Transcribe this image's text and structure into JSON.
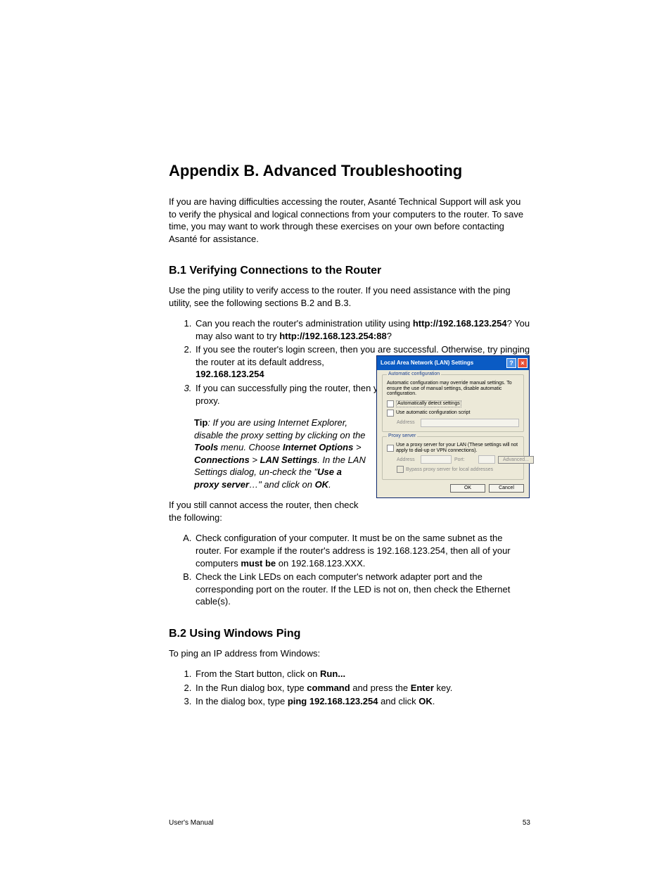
{
  "title": "Appendix B. Advanced Troubleshooting",
  "intro": "If you are having difficulties accessing the router, Asanté Technical Support will ask you to verify the physical and logical connections from your computers to the router. To save time, you may want to work through these exercises on your own before contacting Asanté for assistance.",
  "b1": {
    "heading": "B.1 Verifying Connections to the Router",
    "intro": "Use the ping utility to verify access to the router. If you need assistance with the ping utility, see the following sections B.2 and B.3.",
    "li1_a": "Can you reach the router's administration utility using ",
    "li1_bold1": "http://192.168.123.254",
    "li1_b": "? You may also want to try ",
    "li1_bold2": "http://192.168.123.254:88",
    "li1_c": "?",
    "li2": "If you see the router's login screen, then you are successful. Otherwise, try pinging the router at its default address, ",
    "li2_bold": "192.168.123.254",
    "li3": "If you can successfully ping the router, then you will need to disable your browser's proxy.",
    "tip_label": "Tip",
    "tip_a": ": If you are using Internet Explorer, disable the proxy setting by clicking on the ",
    "tip_b1": "Tools",
    "tip_c": " menu. Choose ",
    "tip_b2": "Internet Options",
    "tip_d": " > ",
    "tip_b3": "Connections",
    "tip_e": " > ",
    "tip_b4": "LAN Settings",
    "tip_f": ". In the LAN Settings dialog, un-check the \"",
    "tip_b5": "Use a proxy server",
    "tip_g": "…\" and click on ",
    "tip_b6": "OK",
    "tip_h": ".",
    "still": "If you still cannot access the router, then check the following:",
    "A_a": "Check configuration of your computer. It must be on the same subnet as the router. For example if the router's address is 192.168.123.254, then all of your computers ",
    "A_bold": "must be",
    "A_b": " on 192.168.123.XXX.",
    "B": "Check the Link LEDs on each computer's network adapter port and the corresponding port on the router. If the LED is not on, then check the Ethernet cable(s)."
  },
  "b2": {
    "heading": "B.2 Using Windows Ping",
    "intro": "To ping an IP address from Windows:",
    "li1_a": "From the Start button, click on ",
    "li1_b": "Run...",
    "li2_a": "In the Run dialog box, type ",
    "li2_b": "command",
    "li2_c": " and press the ",
    "li2_d": "Enter",
    "li2_e": " key.",
    "li3_a": "In the dialog box, type ",
    "li3_b": "ping 192.168.123.254",
    "li3_c": " and click ",
    "li3_d": "OK",
    "li3_e": "."
  },
  "dialog": {
    "title": "Local Area Network (LAN) Settings",
    "auto_label": "Automatic configuration",
    "auto_desc": "Automatic configuration may override manual settings. To ensure the use of manual settings, disable automatic configuration.",
    "detect": "Automatically detect settings",
    "script": "Use automatic configuration script",
    "address": "Address",
    "proxy_label": "Proxy server",
    "proxy_use": "Use a proxy server for your LAN (These settings will not apply to dial-up or VPN connections).",
    "port": "Port:",
    "advanced": "Advanced...",
    "bypass": "Bypass proxy server for local addresses",
    "ok": "OK",
    "cancel": "Cancel"
  },
  "footer_left": "User's Manual",
  "footer_right": "53"
}
